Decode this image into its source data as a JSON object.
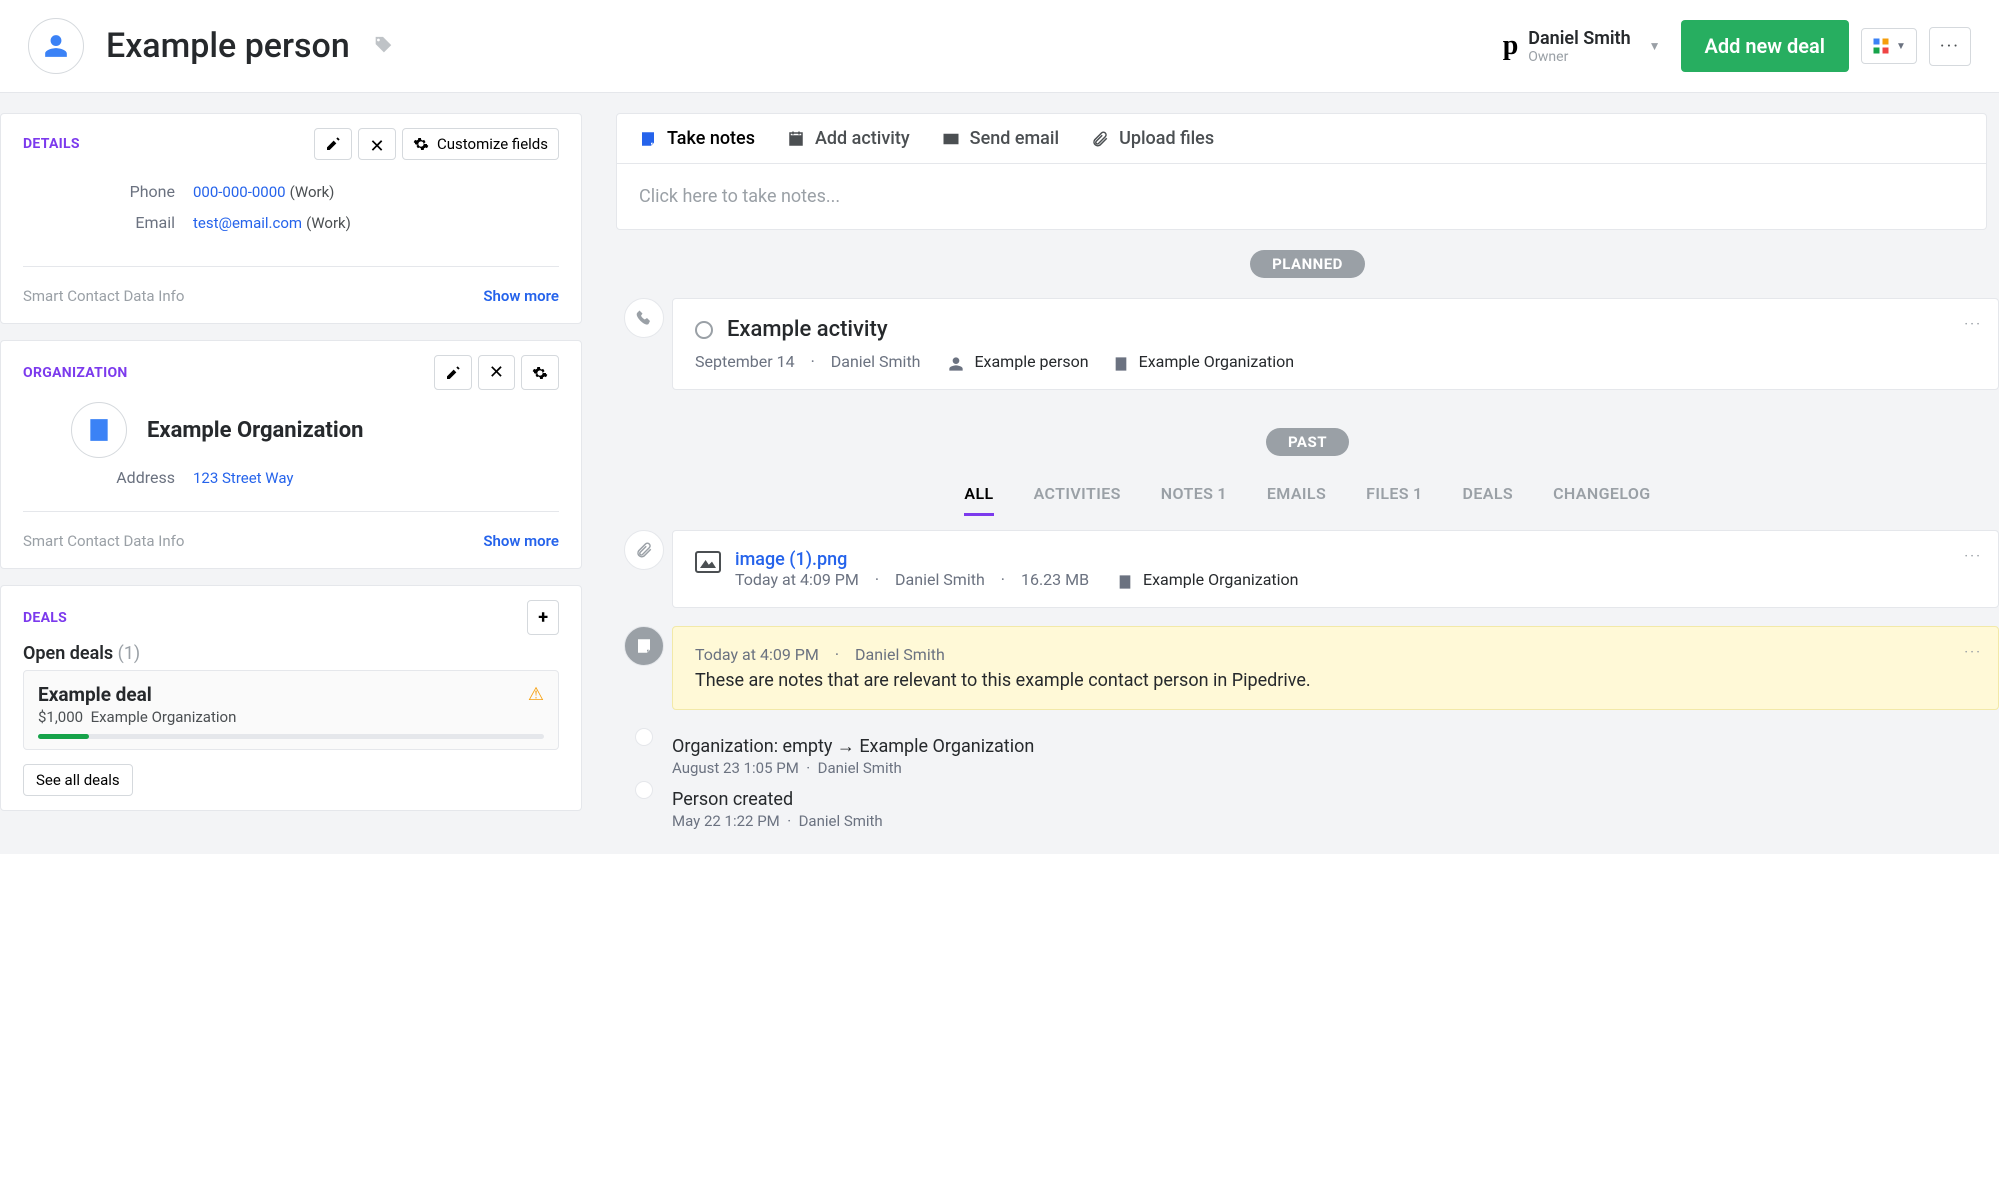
{
  "header": {
    "title": "Example person",
    "owner_name": "Daniel Smith",
    "owner_role": "Owner",
    "add_deal_label": "Add new deal"
  },
  "details": {
    "section_label": "DETAILS",
    "customize_label": "Customize fields",
    "phone_label": "Phone",
    "phone_value": "000-000-0000",
    "phone_type": "(Work)",
    "email_label": "Email",
    "email_value": "test@email.com",
    "email_type": "(Work)",
    "smart_label": "Smart Contact Data Info",
    "show_more": "Show more"
  },
  "organization": {
    "section_label": "ORGANIZATION",
    "name": "Example Organization",
    "address_label": "Address",
    "address_value": "123 Street Way",
    "smart_label": "Smart Contact Data Info",
    "show_more": "Show more"
  },
  "deals": {
    "section_label": "DEALS",
    "open_label": "Open deals",
    "open_count": "(1)",
    "deal_title": "Example deal",
    "deal_amount": "$1,000",
    "deal_org": "Example Organization",
    "see_all": "See all deals"
  },
  "actions": {
    "take_notes": "Take notes",
    "add_activity": "Add activity",
    "send_email": "Send email",
    "upload_files": "Upload files",
    "note_placeholder": "Click here to take notes..."
  },
  "timeline": {
    "planned_label": "PLANNED",
    "past_label": "PAST",
    "activity": {
      "title": "Example activity",
      "date": "September 14",
      "user": "Daniel Smith",
      "person": "Example person",
      "org": "Example Organization"
    },
    "filters": {
      "all": "ALL",
      "activities": "ACTIVITIES",
      "notes": "NOTES",
      "notes_count": "1",
      "emails": "EMAILS",
      "files": "FILES",
      "files_count": "1",
      "deals": "DEALS",
      "changelog": "CHANGELOG"
    },
    "file": {
      "name": "image (1).png",
      "time": "Today at 4:09 PM",
      "user": "Daniel Smith",
      "size": "16.23 MB",
      "org": "Example Organization"
    },
    "note": {
      "time": "Today at 4:09 PM",
      "user": "Daniel Smith",
      "body": "These are notes that are relevant to this example contact person in Pipedrive."
    },
    "change1": {
      "title": "Organization: empty → Example Organization",
      "time": "August 23 1:05 PM",
      "user": "Daniel Smith"
    },
    "change2": {
      "title": "Person created",
      "time": "May 22 1:22 PM",
      "user": "Daniel Smith"
    }
  }
}
